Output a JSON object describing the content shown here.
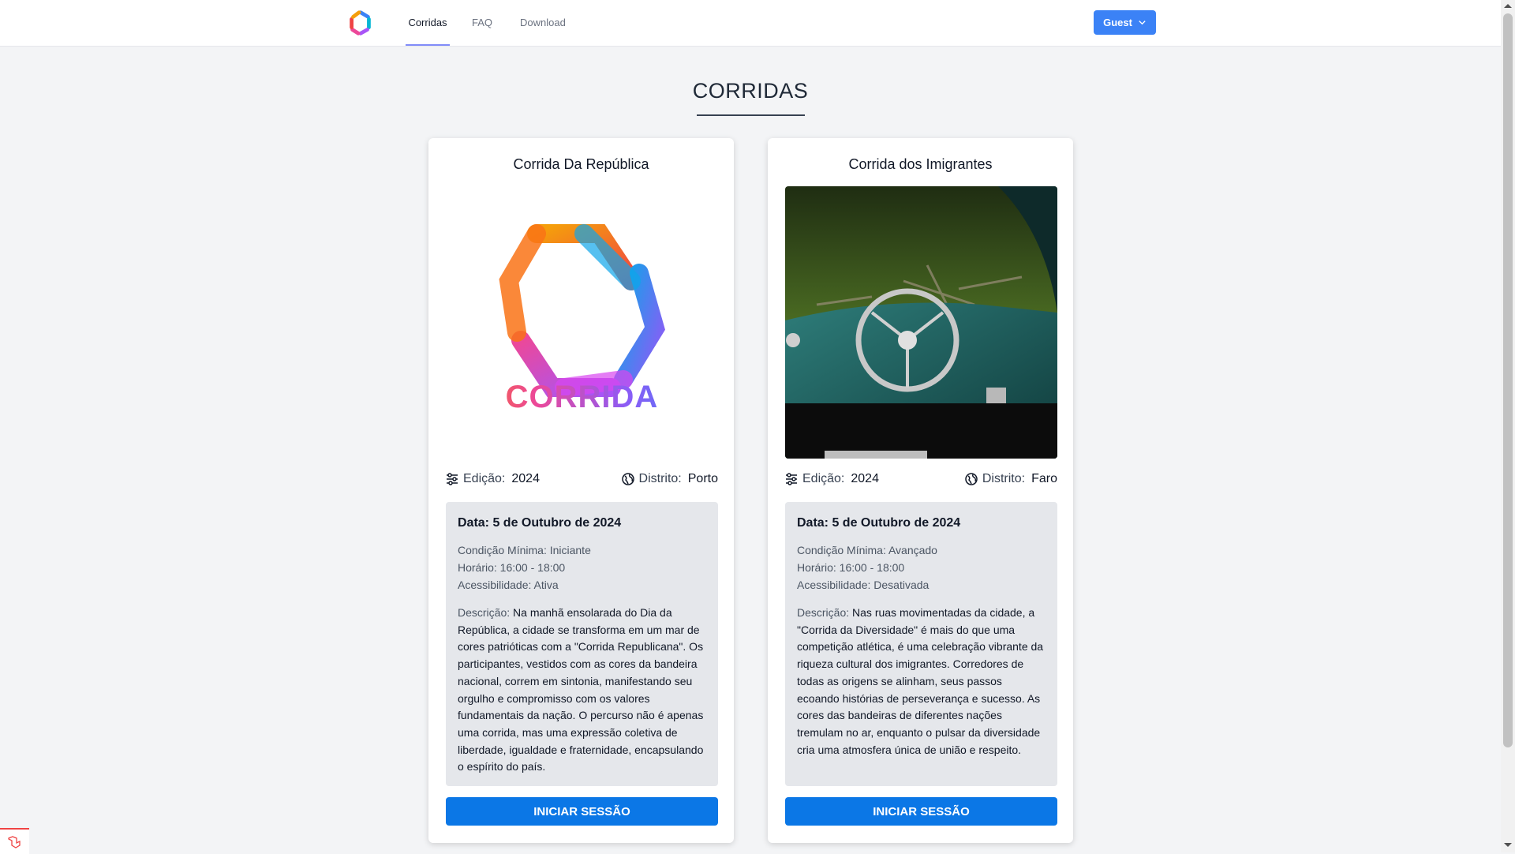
{
  "nav": {
    "links": [
      {
        "label": "Corridas"
      },
      {
        "label": "FAQ"
      },
      {
        "label": "Download"
      }
    ],
    "guest_label": "Guest"
  },
  "page": {
    "title": "CORRIDAS"
  },
  "cards": [
    {
      "title": "Corrida Da República",
      "image_text": "CORRIDA",
      "edicao_label": "Edição:",
      "edicao": "2024",
      "distrito_label": "Distrito:",
      "distrito": "Porto",
      "date": "Data: 5 de Outubro de 2024",
      "condicao": "Condição Mínima: Iniciante",
      "horario": "Horário: 16:00 - 18:00",
      "acessibilidade": "Acessibilidade: Ativa",
      "desc_label": "Descrição:",
      "description": "Na manhã ensolarada do Dia da República, a cidade se transforma em um mar de cores patrióticas com a \"Corrida Republicana\". Os participantes, vestidos com as cores da bandeira nacional, correm em sintonia, manifestando seu orgulho e compromisso com os valores fundamentais da nação. O percurso não é apenas uma corrida, mas uma expressão coletiva de liberdade, igualdade e fraternidade, encapsulando o espírito do país.",
      "button": "INICIAR SESSÃO"
    },
    {
      "title": "Corrida dos Imigrantes",
      "edicao_label": "Edição:",
      "edicao": "2024",
      "distrito_label": "Distrito:",
      "distrito": "Faro",
      "date": "Data: 5 de Outubro de 2024",
      "condicao": "Condição Mínima: Avançado",
      "horario": "Horário: 16:00 - 18:00",
      "acessibilidade": "Acessibilidade: Desativada",
      "desc_label": "Descrição:",
      "description": "Nas ruas movimentadas da cidade, a \"Corrida da Diversidade\" é mais do que uma competição atlética, é uma celebração vibrante da riqueza cultural dos imigrantes. Corredores de todas as origens se alinham, seus passos ecoando histórias de perseverança e sucesso. As cores das bandeiras de diferentes nações tremulam no ar, enquanto o pulsar da diversidade cria uma atmosfera única de união e respeito.",
      "button": "INICIAR SESSÃO"
    }
  ],
  "colors": {
    "accent": "#0b77e6",
    "guest_button": "#3b82f6",
    "nav_underline": "#818cf8",
    "background": "#f3f4f6",
    "info_box": "#e5e7eb"
  },
  "icons": [
    "app-logo-icon",
    "chevron-down-icon",
    "sliders-icon",
    "globe-icon",
    "laravel-icon"
  ]
}
